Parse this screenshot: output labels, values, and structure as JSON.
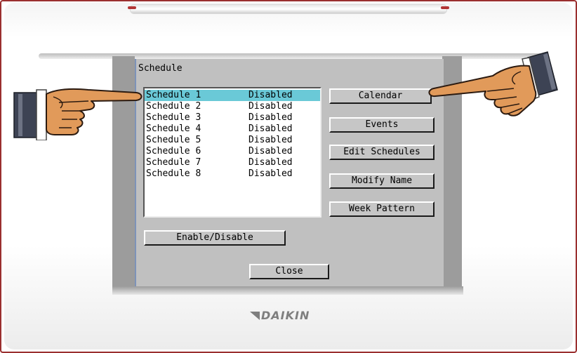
{
  "screen": {
    "title": "Schedule",
    "schedules": [
      {
        "name": "Schedule 1",
        "status": "Disabled",
        "selected": true
      },
      {
        "name": "Schedule 2",
        "status": "Disabled",
        "selected": false
      },
      {
        "name": "Schedule 3",
        "status": "Disabled",
        "selected": false
      },
      {
        "name": "Schedule 4",
        "status": "Disabled",
        "selected": false
      },
      {
        "name": "Schedule 5",
        "status": "Disabled",
        "selected": false
      },
      {
        "name": "Schedule 6",
        "status": "Disabled",
        "selected": false
      },
      {
        "name": "Schedule 7",
        "status": "Disabled",
        "selected": false
      },
      {
        "name": "Schedule 8",
        "status": "Disabled",
        "selected": false
      }
    ],
    "buttons": {
      "calendar": "Calendar",
      "events": "Events",
      "edit_schedules": "Edit Schedules",
      "modify_name": "Modify Name",
      "week_pattern": "Week Pattern",
      "enable_disable": "Enable/Disable",
      "close": "Close"
    }
  },
  "device": {
    "brand": "DAIKIN"
  },
  "colors": {
    "selection": "#6ac9d7",
    "lcd_background": "#c0c0c0",
    "frame_accent": "#9a2f2f"
  },
  "icons": [
    "pointing-hand-left-icon",
    "pointing-hand-right-icon",
    "daikin-logo-mark-icon"
  ]
}
